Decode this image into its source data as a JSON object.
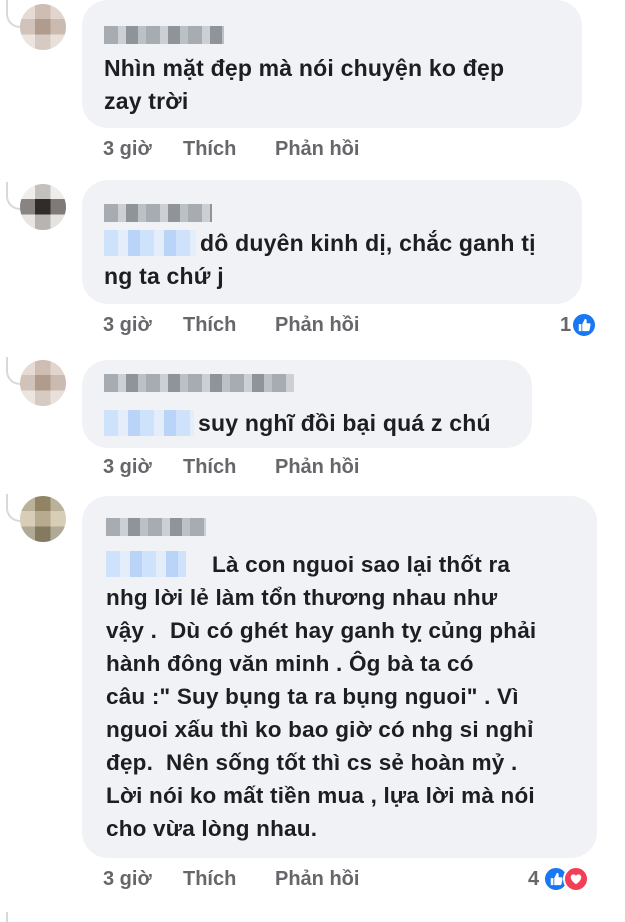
{
  "comments": [
    {
      "text_lines": [
        "Nhìn mặt đẹp mà nói chuyện ko đẹp",
        "zay trời"
      ],
      "time": "3 giờ",
      "like_label": "Thích",
      "reply_label": "Phản hồi",
      "reaction_count": ""
    },
    {
      "text_lines": [
        "dô duyên kinh dị, chắc ganh tị",
        "ng ta chứ j"
      ],
      "time": "3 giờ",
      "like_label": "Thích",
      "reply_label": "Phản hồi",
      "reaction_count": "1"
    },
    {
      "text_lines": [
        "suy nghĩ đồi bại quá z chú"
      ],
      "time": "3 giờ",
      "like_label": "Thích",
      "reply_label": "Phản hồi",
      "reaction_count": ""
    },
    {
      "text_lines": [
        "Là con nguoi sao lại thốt ra",
        "nhg lời lẻ làm tổn thương nhau như",
        "vậy .  Dù có ghét hay ganh tỵ củng phải",
        "hành đông văn minh . Ôg bà ta có",
        "câu :\" Suy bụng ta ra bụng nguoi\" . Vì",
        "nguoi xấu thì ko bao giờ có nhg si nghỉ",
        "đẹp.  Nên sống tốt thì cs sẻ hoàn mỷ .",
        "Lời nói ko mất tiền mua , lựa lời mà nói",
        "cho vừa lòng nhau."
      ],
      "time": "3 giờ",
      "like_label": "Thích",
      "reply_label": "Phản hồi",
      "reaction_count": "4"
    }
  ],
  "icons": {
    "like": "thumbs-up-icon",
    "love": "heart-icon"
  },
  "colors": {
    "bubble": "#f0f2f5",
    "text": "#1c1e21",
    "meta": "#65676b",
    "like": "#1877f2",
    "love": "#f33e58"
  }
}
